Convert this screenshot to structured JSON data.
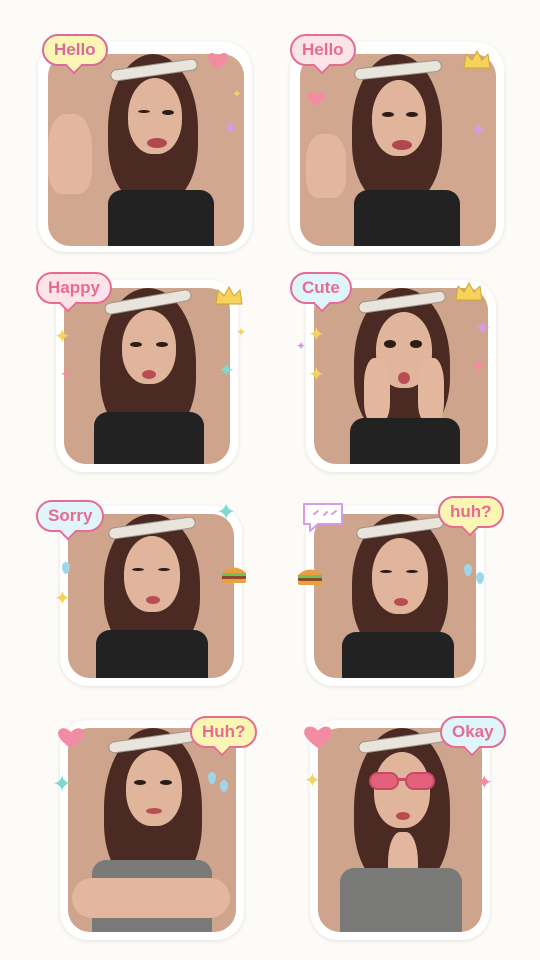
{
  "stickers": [
    {
      "label": "Hello",
      "bubble_fill": "#fbf6b3",
      "bubble_stroke": "#d86a9c"
    },
    {
      "label": "Hello",
      "bubble_fill": "#fde4ea",
      "bubble_stroke": "#e66c93"
    },
    {
      "label": "Happy",
      "bubble_fill": "#fde4ea",
      "bubble_stroke": "#e66c93"
    },
    {
      "label": "Cute",
      "bubble_fill": "#def5f9",
      "bubble_stroke": "#e66c93"
    },
    {
      "label": "Sorry",
      "bubble_fill": "#dff5fa",
      "bubble_stroke": "#e66c93"
    },
    {
      "label": "huh?",
      "bubble_fill": "#fbf6b3",
      "bubble_stroke": "#e66c93"
    },
    {
      "label": "Huh?",
      "bubble_fill": "#fbf6b3",
      "bubble_stroke": "#e66c93"
    },
    {
      "label": "Okay",
      "bubble_fill": "#def5f9",
      "bubble_stroke": "#e66c93"
    }
  ],
  "icons": [
    "heart-icon",
    "crown-icon",
    "sparkle-icon",
    "burger-icon",
    "drop-icon",
    "sunglasses-icon",
    "speech-bubble-icon"
  ],
  "colors": {
    "pink": "#f28ca3",
    "yellow": "#f5d35b",
    "mint": "#7ed9d0",
    "lilac": "#d59be6",
    "sky": "#9fd7ea"
  }
}
